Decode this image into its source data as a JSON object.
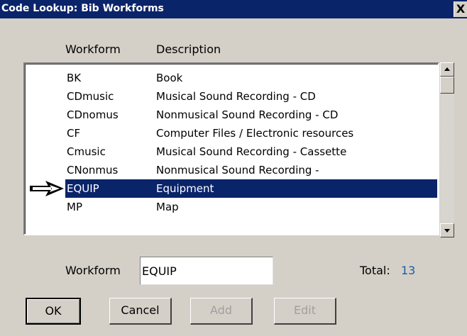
{
  "window": {
    "title": "Code Lookup: Bib Workforms",
    "close_glyph": "X"
  },
  "columns": {
    "workform": "Workform",
    "description": "Description"
  },
  "rows": [
    {
      "code": "BK",
      "desc": "Book"
    },
    {
      "code": "CDmusic",
      "desc": "Musical Sound Recording - CD"
    },
    {
      "code": "CDnomus",
      "desc": "Nonmusical Sound Recording - CD"
    },
    {
      "code": "CF",
      "desc": "Computer Files / Electronic resources"
    },
    {
      "code": "Cmusic",
      "desc": "Musical Sound Recording - Cassette"
    },
    {
      "code": "CNonmus",
      "desc": "Nonmusical Sound Recording -"
    },
    {
      "code": "EQUIP",
      "desc": "Equipment"
    },
    {
      "code": "MP",
      "desc": "Map"
    }
  ],
  "selected_row": "EQUIP",
  "form": {
    "workform_label": "Workform",
    "workform_value": "EQUIP",
    "total_label": "Total:",
    "total_value": "13"
  },
  "buttons": {
    "ok": "OK",
    "cancel": "Cancel",
    "add": "Add",
    "edit": "Edit"
  },
  "colors": {
    "titlebar": "#0a246a",
    "selection": "#0a246a",
    "total": "#1c5ca8",
    "face": "#d4d0c8"
  }
}
